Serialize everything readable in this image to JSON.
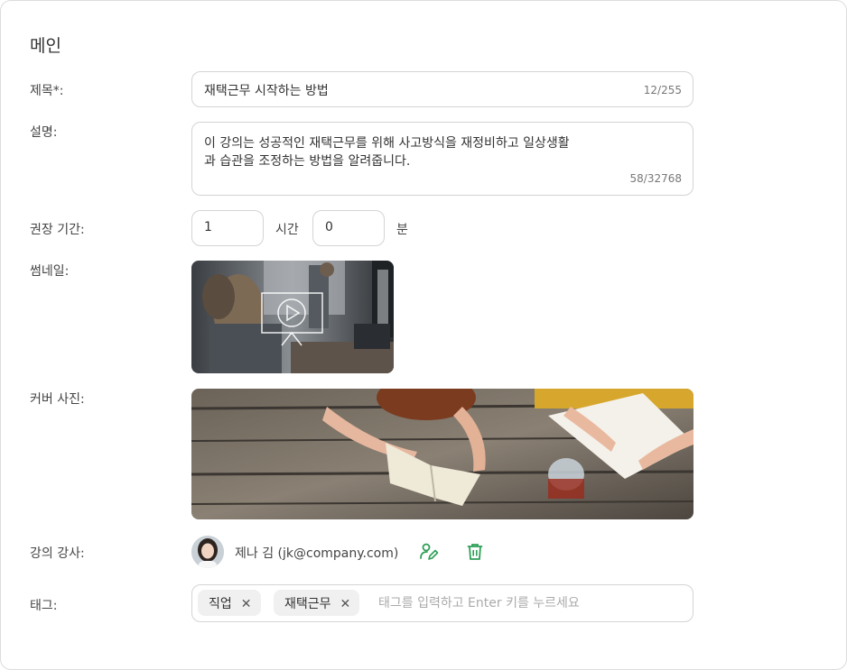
{
  "section": {
    "title": "메인"
  },
  "title_field": {
    "label": "제목*:",
    "value": "재택근무 시작하는 방법",
    "counter": "12/255"
  },
  "description_field": {
    "label": "설명:",
    "line1": "이 강의는 성공적인 재택근무를 위해 사고방식을 재정비하고 일상생활",
    "line2": "과 습관을 조정하는 방법을 알려줍니다.",
    "counter": "58/32768"
  },
  "duration": {
    "label": "권장 기간:",
    "hours": "1",
    "hours_unit": "시간",
    "minutes": "0",
    "minutes_unit": "분"
  },
  "thumbnail": {
    "label": "썸네일:"
  },
  "cover": {
    "label": "커버 사진:"
  },
  "instructor": {
    "label": "강의 강사:",
    "name": "제나 김 (jk@company.com)"
  },
  "tags": {
    "label": "태그:",
    "items": [
      {
        "label": "직업"
      },
      {
        "label": "재택근무"
      }
    ],
    "remove_glyph": "✕",
    "placeholder": "태그를 입력하고 Enter 키를 누르세요"
  },
  "colors": {
    "accent": "#2e9e57",
    "border": "#d4d4d4",
    "chip": "#f0f0f0"
  }
}
